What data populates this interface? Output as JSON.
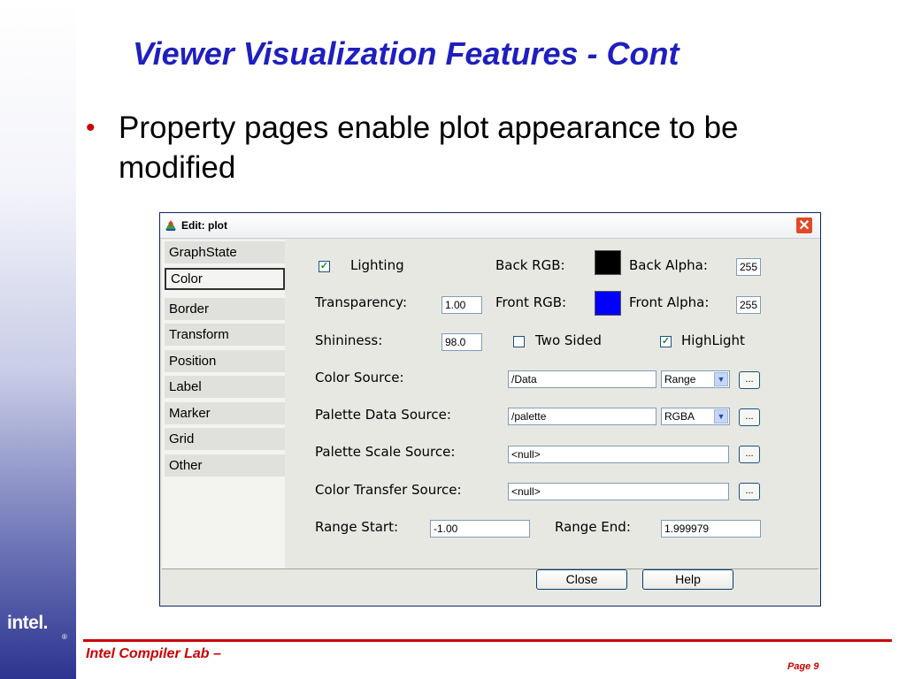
{
  "slide": {
    "title": "Viewer Visualization Features - Cont",
    "bullet": "Property pages enable plot appearance to be modified",
    "footer_left": "Intel Compiler Lab –",
    "footer_right": "Page 9",
    "logo_text": "intel.",
    "logo_mark": "®"
  },
  "dialog": {
    "title": "Edit: plot",
    "close_glyph": "✕",
    "nav_items": [
      "GraphState",
      "Color",
      "Border",
      "Transform",
      "Position",
      "Label",
      "Marker",
      "Grid",
      "Other"
    ],
    "selected_nav": "Color",
    "lighting_label": "Lighting",
    "lighting_checked": true,
    "back_rgb_label": "Back RGB:",
    "back_rgb_color": "#000000",
    "back_alpha_label": "Back Alpha:",
    "back_alpha_value": "255",
    "transparency_label": "Transparency:",
    "transparency_value": "1.00",
    "front_rgb_label": "Front RGB:",
    "front_rgb_color": "#0000ff",
    "front_alpha_label": "Front Alpha:",
    "front_alpha_value": "255",
    "shininess_label": "Shininess:",
    "shininess_value": "98.0",
    "two_sided_label": "Two Sided",
    "two_sided_checked": false,
    "highlight_label": "HighLight",
    "highlight_checked": true,
    "color_source_label": "Color Source:",
    "color_source_value": "/Data",
    "color_source_mode": "Range",
    "palette_data_label": "Palette Data Source:",
    "palette_data_value": "/palette",
    "palette_data_mode": "RGBA",
    "palette_scale_label": "Palette Scale Source:",
    "palette_scale_value": "<null>",
    "color_transfer_label": "Color Transfer Source:",
    "color_transfer_value": "<null>",
    "range_start_label": "Range Start:",
    "range_start_value": "-1.00",
    "range_end_label": "Range End:",
    "range_end_value": "1.999979",
    "ellipsis_label": "...",
    "close_button": "Close",
    "help_button": "Help"
  },
  "colors": {
    "title_blue": "#1f1fbf",
    "accent_red": "#cc0000"
  }
}
